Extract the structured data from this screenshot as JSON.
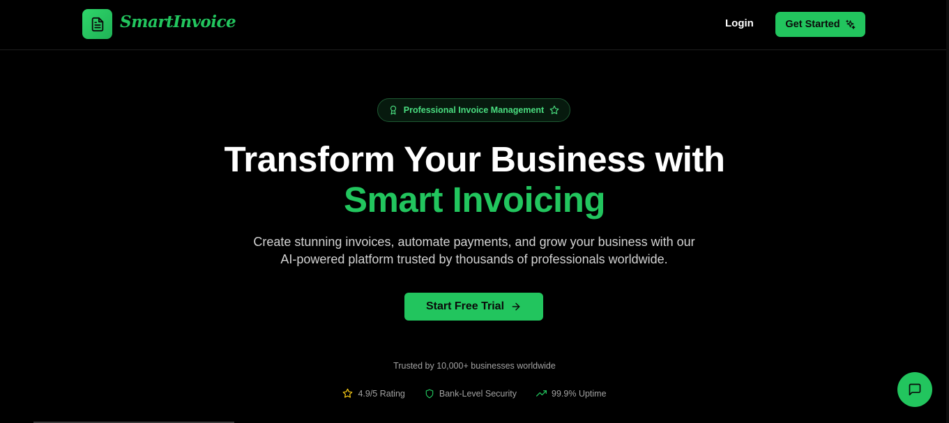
{
  "nav": {
    "brand": "SmartInvoice",
    "login": "Login",
    "get_started": "Get Started"
  },
  "hero": {
    "badge": "Professional Invoice Management",
    "title_line1": "Transform Your Business with",
    "title_line2": "Smart Invoicing",
    "subtitle_line1": "Create stunning invoices, automate payments, and grow your business with our",
    "subtitle_line2": "AI-powered platform trusted by thousands of professionals worldwide.",
    "cta": "Start Free Trial"
  },
  "trust": {
    "text": "Trusted by 10,000+ businesses worldwide",
    "stats": [
      {
        "label": "4.9/5 Rating",
        "icon": "star-icon"
      },
      {
        "label": "Bank-Level Security",
        "icon": "shield-icon"
      },
      {
        "label": "99.9% Uptime",
        "icon": "trending-up-icon"
      }
    ]
  },
  "colors": {
    "accent": "#22c55e",
    "background": "#000000",
    "star": "#facc15"
  }
}
